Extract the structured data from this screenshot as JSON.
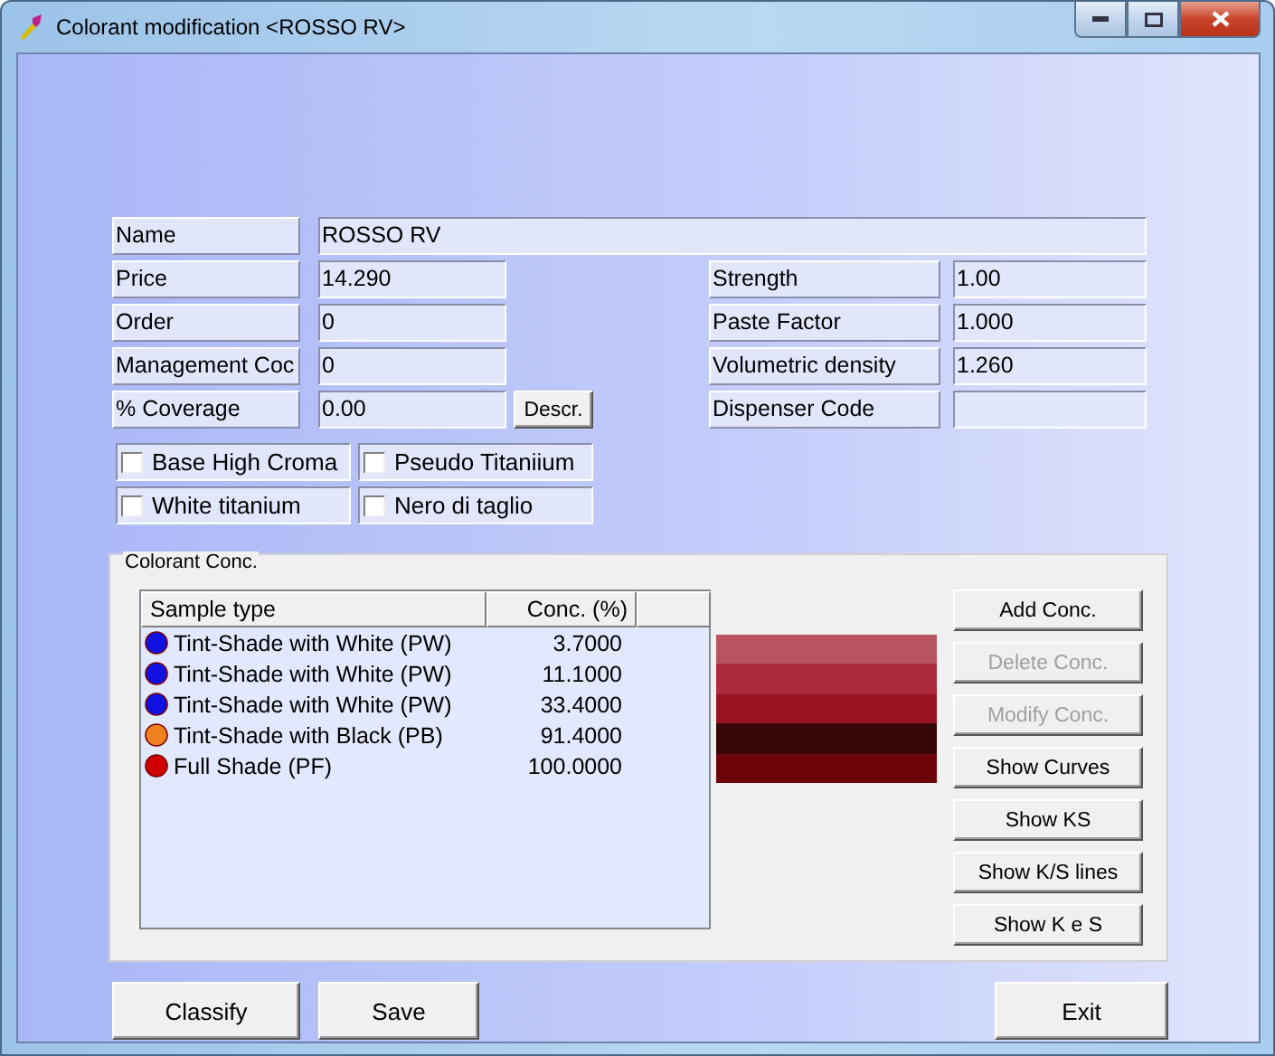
{
  "window": {
    "title": "Colorant modification <ROSSO RV>"
  },
  "name": {
    "label": "Name",
    "value": "ROSSO RV"
  },
  "left_fields": [
    {
      "label": "Price",
      "value": "14.290"
    },
    {
      "label": "Order",
      "value": "0"
    },
    {
      "label": "Management Coc",
      "value": "0"
    },
    {
      "label": "% Coverage",
      "value": "0.00"
    }
  ],
  "descr_button": "Descr.",
  "right_fields": [
    {
      "label": "Strength",
      "value": "1.00"
    },
    {
      "label": "Paste Factor",
      "value": "1.000"
    },
    {
      "label": "Volumetric density",
      "value": "1.260"
    },
    {
      "label": "Dispenser Code"
    }
  ],
  "checkboxes": [
    {
      "label": "Base High Croma",
      "checked": false
    },
    {
      "label": "Pseudo Titaniium",
      "checked": false
    },
    {
      "label": "White titanium",
      "checked": false
    },
    {
      "label": "Nero di taglio",
      "checked": false
    }
  ],
  "conc_group": {
    "title": "Colorant Conc.",
    "columns": [
      "Sample type",
      "Conc. (%)"
    ],
    "rows": [
      {
        "sample_type": "Tint-Shade with White (PW)",
        "conc": "3.7000",
        "color": "#1010e0"
      },
      {
        "sample_type": "Tint-Shade with White (PW)",
        "conc": "11.1000",
        "color": "#1010e0"
      },
      {
        "sample_type": "Tint-Shade with White (PW)",
        "conc": "33.4000",
        "color": "#1010e0"
      },
      {
        "sample_type": "Tint-Shade with Black (PB)",
        "conc": "91.4000",
        "color": "#f08020"
      },
      {
        "sample_type": "Full Shade  (PF)",
        "conc": "100.0000",
        "color": "#d00000"
      }
    ],
    "swatches": [
      {
        "color": "#b85462"
      },
      {
        "color": "#ad2a3e"
      },
      {
        "color": "#991422"
      },
      {
        "color": "#350707"
      },
      {
        "color": "#6d0508"
      }
    ],
    "buttons": [
      {
        "label": "Add Conc.",
        "disabled": false
      },
      {
        "label": "Delete Conc.",
        "disabled": true
      },
      {
        "label": "Modify Conc.",
        "disabled": true
      },
      {
        "label": "Show Curves",
        "disabled": false
      },
      {
        "label": "Show KS",
        "disabled": false
      },
      {
        "label": "Show K/S lines",
        "disabled": false
      },
      {
        "label": "Show K e S",
        "disabled": false
      }
    ]
  },
  "bottom_buttons": [
    {
      "label": "Classify"
    },
    {
      "label": "Save"
    },
    {
      "label": "Exit"
    }
  ]
}
